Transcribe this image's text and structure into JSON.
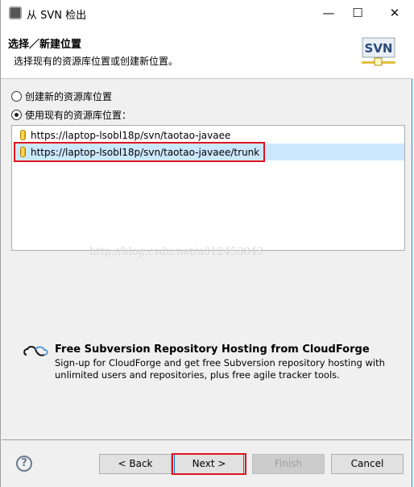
{
  "window": {
    "title": "从 SVN 检出",
    "controls": {
      "minimize": "—",
      "maximize": "☐",
      "close": "✕"
    }
  },
  "header": {
    "title": "选择／新建位置",
    "description": "选择现有的资源库位置或创建新位置。",
    "logo_text": "SVN"
  },
  "options": [
    {
      "label": "创建新的资源库位置",
      "selected": false
    },
    {
      "label": "使用现有的资源库位置：",
      "selected": true
    }
  ],
  "repositories": [
    {
      "url": "https://laptop-lsobl18p/svn/taotao-javaee",
      "selected": false
    },
    {
      "url": "https://laptop-lsobl18p/svn/taotao-javaee/trunk",
      "selected": true
    }
  ],
  "watermark": "http://blog.csdn.net/u012453843",
  "cloudforge": {
    "title": "Free Subversion Repository Hosting from CloudForge",
    "description": "Sign-up for CloudForge and get free Subversion repository hosting with unlimited users and repositories, plus free agile tracker tools."
  },
  "buttons": {
    "help": "?",
    "back": "< Back",
    "next": "Next >",
    "finish": "Finish",
    "cancel": "Cancel"
  },
  "colors": {
    "highlight": "#e0141e",
    "selection": "#cce8ff"
  }
}
